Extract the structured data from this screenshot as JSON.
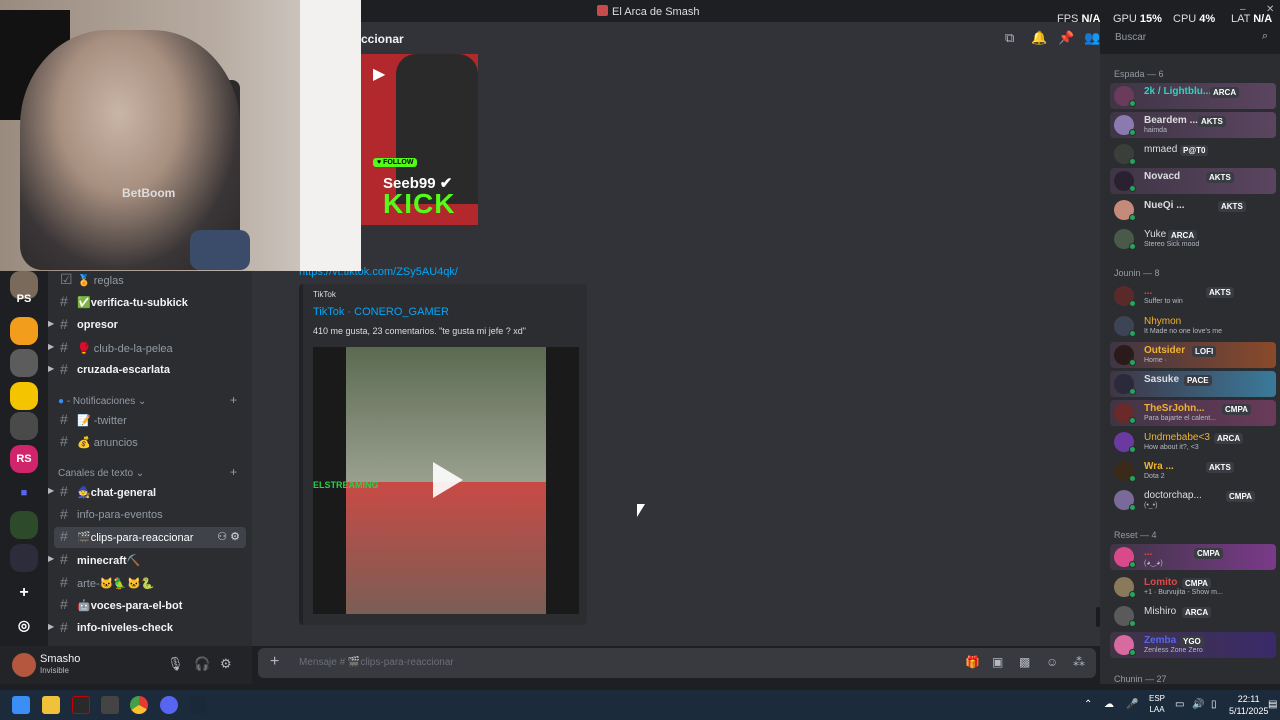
{
  "window": {
    "title": "El Arca de Smash",
    "minimize": "–",
    "close": "✕"
  },
  "perf": {
    "fps_label": "FPS",
    "fps": "N/A",
    "gpu_label": "GPU",
    "gpu": "15%",
    "cpu_label": "CPU",
    "cpu": "4%",
    "lat_label": "LAT",
    "lat": "N/A"
  },
  "header": {
    "channel_name": "ccionar",
    "search_placeholder": "Buscar"
  },
  "servers": [
    "PS",
    "RS"
  ],
  "channels": [
    {
      "label": "reglas",
      "emoji": "🏅",
      "style": "dim"
    },
    {
      "label": "verifica-tu-subkick",
      "emoji": "✅",
      "style": "bright"
    },
    {
      "label": "opresor",
      "style": "bright",
      "arrow": true
    },
    {
      "label": "club-de-la-pelea",
      "emoji": "🥊",
      "style": "dim",
      "arrow": true
    },
    {
      "label": "cruzada-escarlata",
      "style": "bright",
      "arrow": true
    },
    {
      "label": "-twitter",
      "emoji": "📝",
      "style": "dim"
    },
    {
      "label": "anuncios",
      "emoji": "💰",
      "style": "dim"
    },
    {
      "label": "chat-general",
      "emoji": "🧙",
      "style": "bright",
      "arrow": true
    },
    {
      "label": "info-para-eventos",
      "style": "dim"
    },
    {
      "label": "clips-para-reaccionar",
      "emoji": "🎬",
      "style": "active"
    },
    {
      "label": "minecraft⛏️",
      "style": "bright",
      "arrow": true
    },
    {
      "label": "arte-🐱🦜🐱🐍",
      "style": "dim"
    },
    {
      "label": "voces-para-el-bot",
      "emoji": "🤖",
      "style": "bright"
    },
    {
      "label": "info-niveles-check",
      "style": "bright",
      "arrow": true
    }
  ],
  "categories": {
    "notificaciones": "- Notificaciones",
    "canales": "Canales de texto"
  },
  "user": {
    "name": "Smasho",
    "status": "Invisible"
  },
  "message": {
    "link": "https://vt.tiktok.com/ZSy5AU4qk/",
    "embed_provider": "TikTok",
    "embed_title": "TikTok · CONERO_GAMER",
    "embed_desc": "410 me gusta, 23 comentarios. \"te gusta mi jefe ? xd\"",
    "video_overlay": "ELSTREAMING",
    "kick_follow": "♥ FOLLOW",
    "kick_name": "Seeb99 ✔",
    "kick_brand": "KICK",
    "shirt_text": "BetBoom",
    "composer_placeholder": "Mensaje # 🎬clips-para-reaccionar"
  },
  "members": {
    "groups": [
      {
        "title": "Espada — 6",
        "items": [
          {
            "name": "2k / Lightblu...",
            "tag": "ARCA",
            "color": "#2dd4bf",
            "banner": true
          },
          {
            "name": "Beardem ...",
            "tag": "AKTS",
            "sub": "haimda",
            "color": "#dbdee1",
            "banner": true
          },
          {
            "name": "mmaed",
            "tag": "P@T0",
            "color": "#dbdee1"
          },
          {
            "name": "Novacd",
            "tag": "AKTS",
            "color": "#dbdee1",
            "banner": true
          },
          {
            "name": "NueQi ...",
            "tag": "AKTS",
            "color": "#dbdee1"
          },
          {
            "name": "Yuke",
            "tag": "ARCA",
            "sub": "Stereo Sick mood",
            "color": "#dbdee1"
          }
        ]
      },
      {
        "title": "Jounin — 8",
        "items": [
          {
            "name": "...",
            "tag": "AKTS",
            "sub": "Suffer to win",
            "color": "#e04848"
          },
          {
            "name": "Nhymon",
            "sub": "It Made no one love's me",
            "color": "#f0b232"
          },
          {
            "name": "Outsider",
            "tag": "LOFI",
            "sub": "Home · ",
            "color": "#f0b232",
            "banner": true
          },
          {
            "name": "Sasuke",
            "tag": "PACE",
            "color": "#dbdee1",
            "banner": true
          },
          {
            "name": "TheSrJohn...",
            "tag": "CMPA",
            "sub": "Para bajarte el calent...",
            "color": "#f0b232",
            "banner": true
          },
          {
            "name": "Undmebabe<3",
            "tag": "ARCA",
            "sub": "How about it?, <3",
            "color": "#f0b232"
          },
          {
            "name": "Wra ...",
            "tag": "AKTS",
            "sub": "Dota 2",
            "color": "#f0b232"
          },
          {
            "name": "doctorchap...",
            "tag": "CMPA",
            "sub": "(•_•)",
            "color": "#dbdee1"
          }
        ]
      },
      {
        "title": "Reset — 4",
        "items": [
          {
            "name": "...",
            "tag": "CMPA",
            "sub": "(◕‿◕)",
            "color": "#e04848",
            "banner": true
          },
          {
            "name": "Lomito",
            "tag": "CMPA",
            "sub": "+1 · Burvujita - Show m...",
            "color": "#e04848"
          },
          {
            "name": "Mishiro",
            "tag": "ARCA",
            "color": "#dbdee1"
          },
          {
            "name": "Zemba",
            "tag": "YGO",
            "sub": "Zenless Zone Zero",
            "color": "#5865f2",
            "banner": true
          }
        ]
      },
      {
        "title": "Chunin — 27",
        "items": []
      }
    ]
  },
  "taskbar": {
    "lang": "ESP",
    "lang2": "LAA",
    "time": "22:11",
    "date": "5/11/2025"
  }
}
